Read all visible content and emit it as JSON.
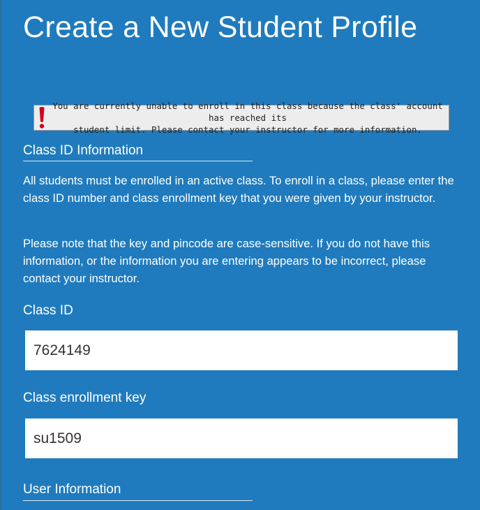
{
  "page": {
    "title": "Create a New Student Profile"
  },
  "alert": {
    "icon": "exclamation-icon",
    "icon_color": "#d0021b",
    "line1": "You are currently unable to enroll in this class because the class' account has reached its",
    "line2": "student limit. Please contact your instructor for more information."
  },
  "class_section": {
    "heading": "Class ID Information",
    "intro": "All students must be enrolled in an active class. To enroll in a class, please enter the class ID number and class enrollment key that you were given by your instructor.",
    "note": "Please note that the key and pincode are case-sensitive. If you do not have this information, or the information you are entering appears to be incorrect, please contact your instructor."
  },
  "fields": {
    "class_id": {
      "label": "Class ID",
      "value": "7624149"
    },
    "enrollment_key": {
      "label": "Class enrollment key",
      "value": "su1509"
    }
  },
  "user_section": {
    "heading": "User Information"
  },
  "colors": {
    "background": "#1f7bbd",
    "alert_background": "#ededed",
    "text": "#ffffff"
  }
}
